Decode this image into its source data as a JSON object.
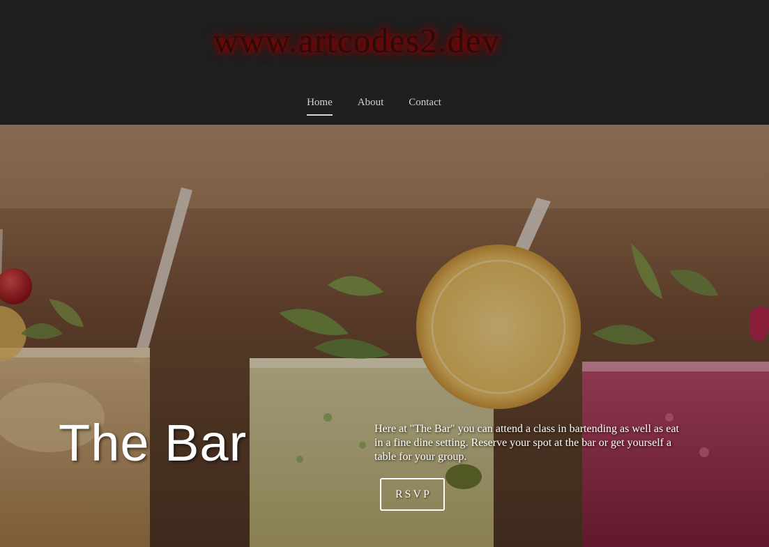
{
  "header": {
    "logo_text": "www.artcodes2.dev",
    "nav": [
      {
        "label": "Home",
        "active": true
      },
      {
        "label": "About",
        "active": false
      },
      {
        "label": "Contact",
        "active": false
      }
    ]
  },
  "hero": {
    "title": "The Bar",
    "description": "Here at \"The Bar\" you can attend a class in bartending as well as eat in a fine dine setting. Reserve your spot at the bar or get yourself a table for your group.",
    "button_label": "RSVP"
  },
  "colors": {
    "header_bg": "#1f1f1f",
    "logo_glow": "#8a0000",
    "text": "#ffffff"
  }
}
